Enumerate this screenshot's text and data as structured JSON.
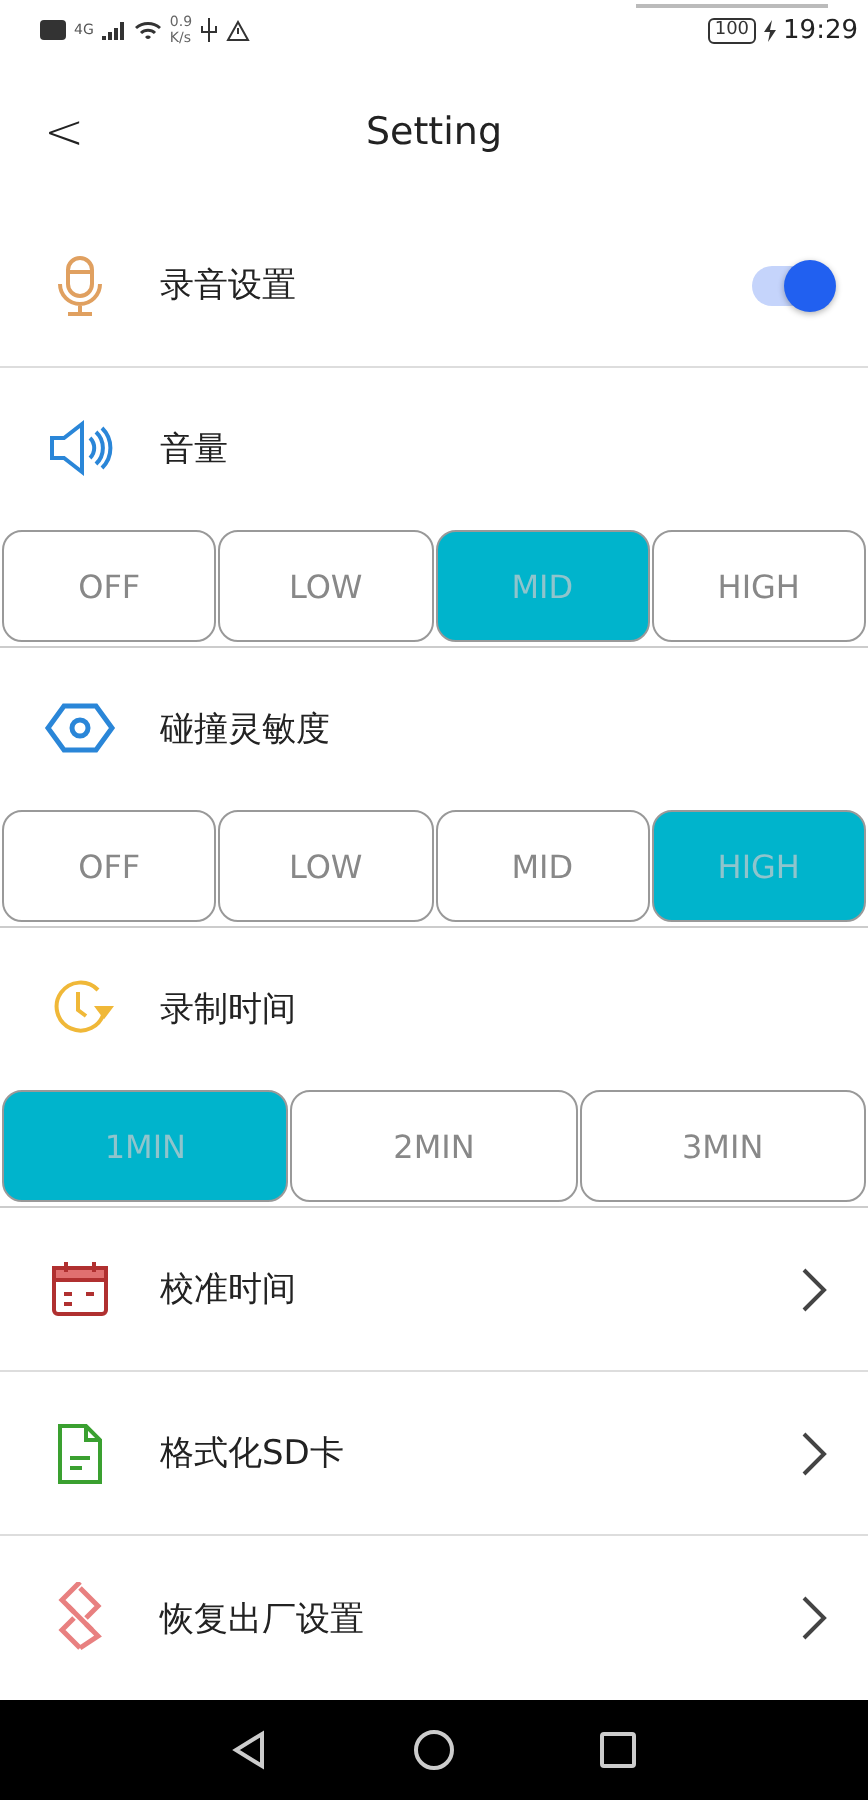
{
  "status_bar": {
    "network": "4G",
    "speed_value": "0.9",
    "speed_unit": "K/s",
    "battery": "100",
    "time": "19:29"
  },
  "header": {
    "back": "<",
    "title": "Setting"
  },
  "sections": [
    {
      "kind": "toggle",
      "label": "录音设置",
      "on": true
    },
    {
      "kind": "segmented",
      "label": "音量",
      "options": [
        {
          "label": "OFF",
          "selected": false
        },
        {
          "label": "LOW",
          "selected": false
        },
        {
          "label": "MID",
          "selected": true
        },
        {
          "label": "HIGH",
          "selected": false
        }
      ]
    },
    {
      "kind": "segmented",
      "label": "碰撞灵敏度",
      "options": [
        {
          "label": "OFF",
          "selected": false
        },
        {
          "label": "LOW",
          "selected": false
        },
        {
          "label": "MID",
          "selected": false
        },
        {
          "label": "HIGH",
          "selected": true
        }
      ]
    },
    {
      "kind": "segmented",
      "label": "录制时间",
      "options": [
        {
          "label": "1MIN",
          "selected": true
        },
        {
          "label": "2MIN",
          "selected": false
        },
        {
          "label": "3MIN",
          "selected": false
        }
      ]
    },
    {
      "kind": "link",
      "label": "校准时间"
    },
    {
      "kind": "link",
      "label": "格式化SD卡"
    },
    {
      "kind": "link",
      "label": "恢复出厂设置"
    }
  ]
}
